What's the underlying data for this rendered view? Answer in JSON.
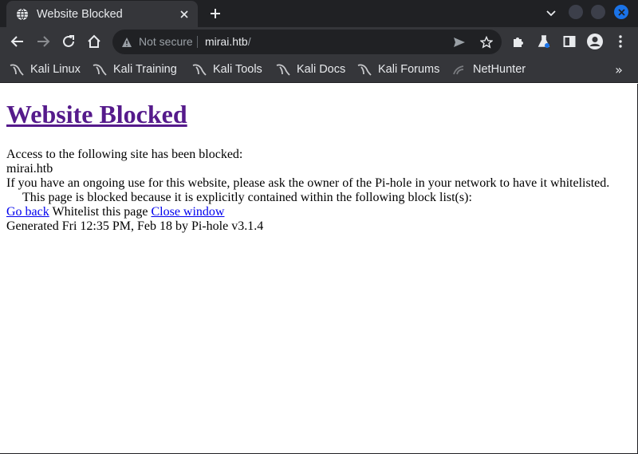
{
  "browser": {
    "tab": {
      "title": "Website Blocked"
    },
    "omnibox": {
      "security_label": "Not secure",
      "host": "mirai.htb",
      "path": "/"
    },
    "bookmarks": [
      {
        "label": "Kali Linux"
      },
      {
        "label": "Kali Training"
      },
      {
        "label": "Kali Tools"
      },
      {
        "label": "Kali Docs"
      },
      {
        "label": "Kali Forums"
      },
      {
        "label": "NetHunter"
      }
    ],
    "more_bookmarks": "»",
    "colors": {
      "chrome_bg": "#202124",
      "toolbar_bg": "#35363a",
      "accent": "#1a73e8"
    }
  },
  "page": {
    "heading": "Website Blocked",
    "intro": "Access to the following site has been blocked:",
    "blocked_domain": "mirai.htb",
    "whitelist_message": "If you have an ongoing use for this website, please ask the owner of the Pi-hole in your network to have it whitelisted.",
    "block_list_message": "This page is blocked because it is explicitly contained within the following block list(s):",
    "actions": {
      "go_back": "Go back",
      "whitelist": "Whitelist this page",
      "close": "Close window"
    },
    "footer": "Generated Fri 12:35 PM, Feb 18 by Pi-hole v3.1.4",
    "colors": {
      "visited_link": "#551a8b",
      "link": "#0000ee"
    }
  }
}
